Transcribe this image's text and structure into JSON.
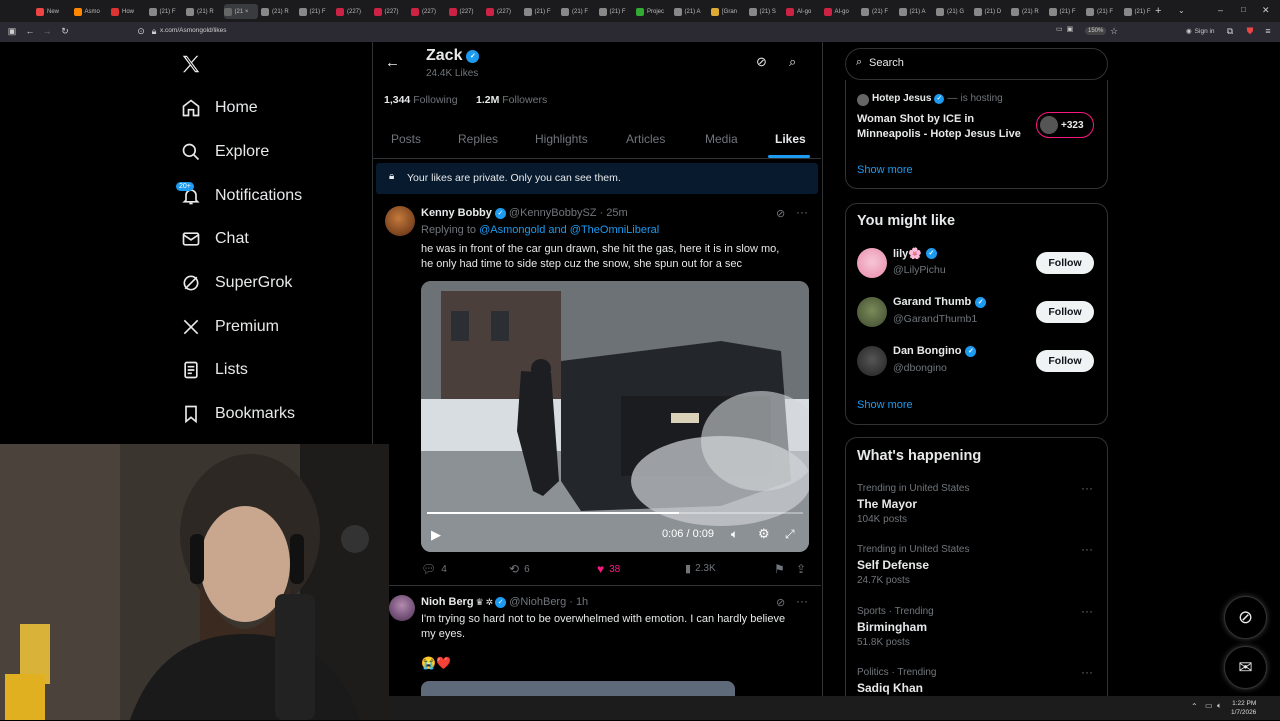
{
  "browser": {
    "tabs": [
      "New",
      "Asmo",
      "How",
      "(21) F",
      "(21) R",
      "(21 ×",
      "(21) R",
      "(21) F",
      "(227)",
      "(227)",
      "(227)",
      "(227)",
      "(227)",
      "(21) F",
      "(21) F",
      "(21) F",
      "Projec",
      "(21) A",
      "[Gran",
      "(21) S",
      "AI-go",
      "AI-go",
      "(21) F",
      "(21) A",
      "(21) G",
      "(21) D",
      "(21) R",
      "(21) F",
      "(21) F",
      "(21) F"
    ],
    "url": "x.com/Asmongold/likes",
    "zoom": "150%",
    "sign_in": "Sign in"
  },
  "nav": {
    "items": [
      {
        "label": "Home",
        "icon": "home-icon"
      },
      {
        "label": "Explore",
        "icon": "search-icon"
      },
      {
        "label": "Notifications",
        "icon": "bell-icon"
      },
      {
        "label": "Chat",
        "icon": "mail-icon"
      },
      {
        "label": "SuperGrok",
        "icon": "grok-icon"
      },
      {
        "label": "Premium",
        "icon": "x-logo-icon"
      },
      {
        "label": "Lists",
        "icon": "list-icon"
      },
      {
        "label": "Bookmarks",
        "icon": "bookmark-icon"
      }
    ],
    "notifications_badge": "20+"
  },
  "profile": {
    "name": "Zack",
    "likes_count": "24.4K Likes",
    "following_count": "1,344",
    "following_label": "Following",
    "followers_count": "1.2M",
    "followers_label": "Followers",
    "tabs": [
      "Posts",
      "Replies",
      "Highlights",
      "Articles",
      "Media",
      "Likes"
    ],
    "active_tab": "Likes",
    "private_notice": "Your likes are private. Only you can see them."
  },
  "posts": [
    {
      "author": "Kenny Bobby",
      "handle": "@KennyBobbySZ",
      "time": "· 25m",
      "reply_prefix": "Replying to",
      "reply_to": "@Asmongold and @TheOmniLiberal",
      "text_line1": "he was in front of the car gun drawn, she hit the gas, here it is in slow mo,",
      "text_line2": "he only had time to side step cuz the snow, she spun out for a sec",
      "video_time": "0:06 / 0:09",
      "video_progress": 0.67,
      "replies": "4",
      "reposts": "6",
      "likes": "38",
      "views": "2.3K"
    },
    {
      "author": "Nioh Berg",
      "handle": "@NiohBerg",
      "time": "· 1h",
      "text_line1": "I'm trying so hard not to be overwhelmed with emotion. I can hardly believe",
      "text_line2": "my eyes.",
      "emoji": "😭❤️"
    }
  ],
  "right": {
    "search_placeholder": "Search",
    "space": {
      "host": "Hotep Jesus",
      "status": "is hosting",
      "title_line1": "Woman Shot by ICE in",
      "title_line2": "Minneapolis - Hotep Jesus Live",
      "listeners": "+323",
      "show_more": "Show more"
    },
    "you_might_like": {
      "title": "You might like",
      "users": [
        {
          "name": "lily🌸",
          "handle": "@LilyPichu",
          "button": "Follow"
        },
        {
          "name": "Garand Thumb",
          "handle": "@GarandThumb1",
          "button": "Follow"
        },
        {
          "name": "Dan Bongino",
          "handle": "@dbongino",
          "button": "Follow"
        }
      ],
      "show_more": "Show more"
    },
    "whats_happening": {
      "title": "What's happening",
      "trends": [
        {
          "category": "Trending in United States",
          "name": "The Mayor",
          "count": "104K posts"
        },
        {
          "category": "Trending in United States",
          "name": "Self Defense",
          "count": "24.7K posts"
        },
        {
          "category": "Sports · Trending",
          "name": "Birmingham",
          "count": "51.8K posts"
        },
        {
          "category": "Politics · Trending",
          "name": "Sadiq Khan",
          "count": ""
        }
      ]
    }
  },
  "taskbar": {
    "time": "1:22 PM",
    "date": "1/7/2026"
  }
}
